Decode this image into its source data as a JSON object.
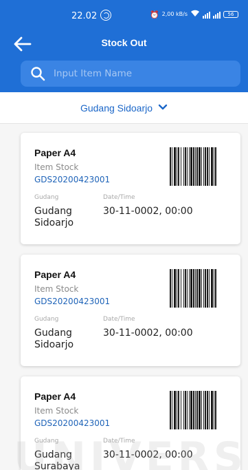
{
  "status_bar": {
    "time": "22.02",
    "data_speed": "2,00 kB/s",
    "battery": "56"
  },
  "header": {
    "title": "Stock Out",
    "back_icon": "arrow-left-icon"
  },
  "search": {
    "placeholder": "Input Item Name",
    "icon": "search-icon"
  },
  "warehouse_selector": {
    "selected": "Gudang Sidoarjo",
    "icon": "chevron-down-icon"
  },
  "items": [
    {
      "name": "Paper A4",
      "type": "Item Stock",
      "code": "GDS20200423001",
      "gudang_label": "Gudang",
      "gudang": "Gudang Sidoarjo",
      "datetime_label": "Date/Time",
      "datetime": "30-11-0002, 00:00"
    },
    {
      "name": "Paper A4",
      "type": "Item Stock",
      "code": "GDS20200423001",
      "gudang_label": "Gudang",
      "gudang": "Gudang Sidoarjo",
      "datetime_label": "Date/Time",
      "datetime": "30-11-0002, 00:00"
    },
    {
      "name": "Paper A4",
      "type": "Item Stock",
      "code": "GDS20200423001",
      "gudang_label": "Gudang",
      "gudang": "Gudang Surabaya",
      "datetime_label": "Date/Time",
      "datetime": "30-11-0002, 00:00"
    }
  ],
  "watermark": "UNIVERS",
  "colors": {
    "header_bg": "#1f6fd6",
    "search_bg": "#3a84e4",
    "accent_text": "#1a66c8",
    "code_text": "#1e63b8"
  }
}
